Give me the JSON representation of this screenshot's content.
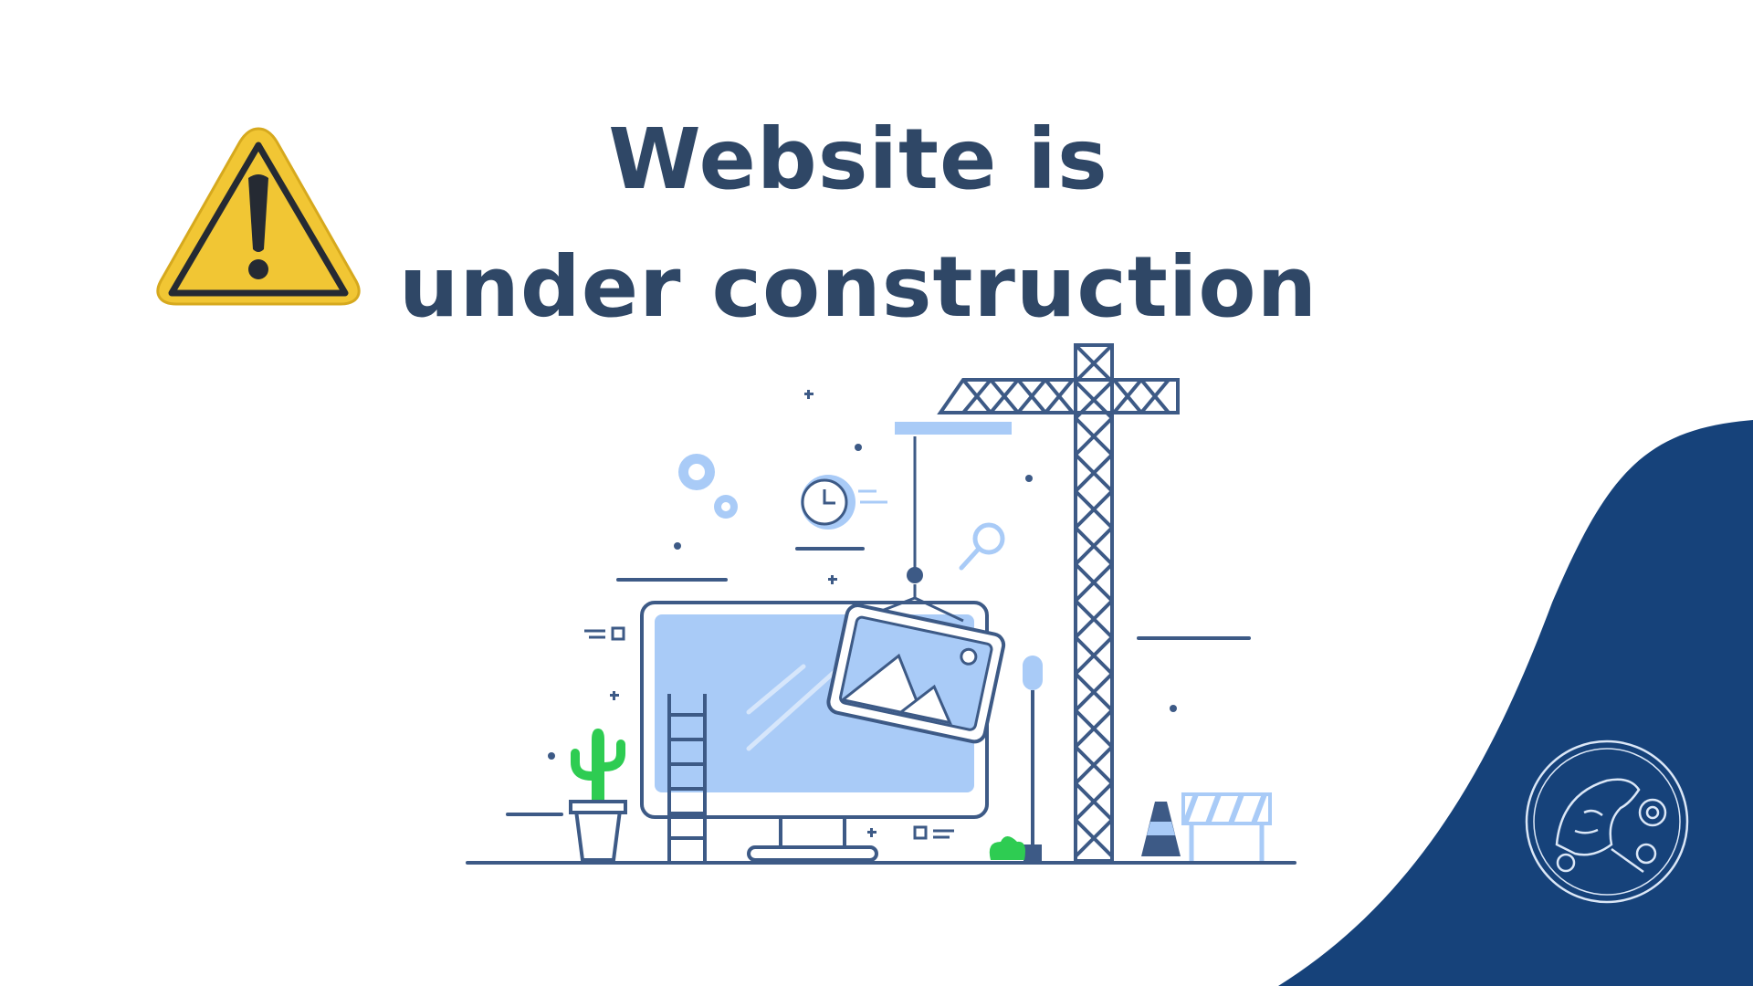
{
  "page": {
    "headline": {
      "line1": "Website is",
      "line2": "under construction"
    },
    "icons": {
      "warning": "warning-triangle-icon",
      "illustration": "construction-illustration",
      "emblem": "panther-gear-emblem"
    }
  },
  "colors": {
    "background": "#ffffff",
    "headline": "#2f4766",
    "wave": "#16427a",
    "warning_fill": "#f1c634",
    "illustration_outline": "#3d5a86",
    "illustration_fill": "#a9cbf7",
    "cactus": "#2ecc52"
  }
}
